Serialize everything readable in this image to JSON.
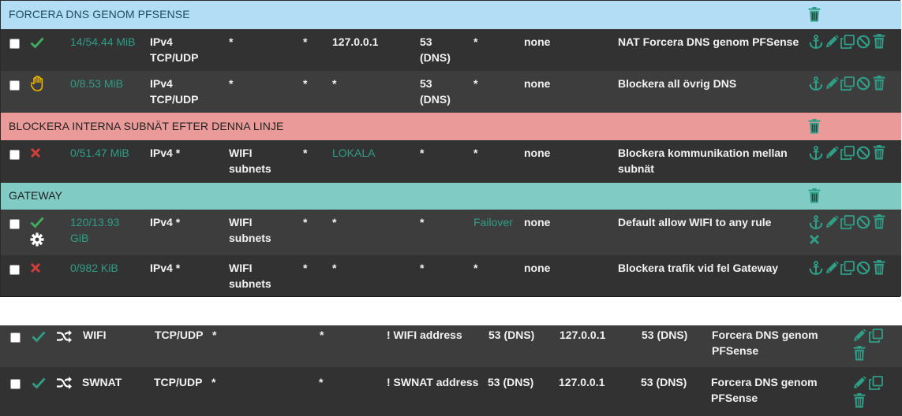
{
  "colors": {
    "accent": "#2e9e87",
    "sep_blue": "#b3ddf5",
    "sep_red": "#eb9a9a",
    "sep_teal": "#80cbc4"
  },
  "rules": {
    "sep1": "FORCERA DNS GENOM PFSENSE",
    "row1": {
      "states": "14/54.44 MiB",
      "proto1": "IPv4",
      "proto2": "TCP/UDP",
      "source": "*",
      "port": "*",
      "dest": "127.0.0.1",
      "dport1": "53",
      "dport2": "(DNS)",
      "gw": "*",
      "queue": "none",
      "desc": "NAT Forcera DNS genom PFSense"
    },
    "row2": {
      "states": "0/8.53 MiB",
      "proto1": "IPv4",
      "proto2": "TCP/UDP",
      "source": "*",
      "port": "*",
      "dest": "*",
      "dport1": "53",
      "dport2": "(DNS)",
      "gw": "*",
      "queue": "none",
      "desc": "Blockera all övrig DNS"
    },
    "sep2": "BLOCKERA INTERNA SUBNÄT EFTER DENNA LINJE",
    "row3": {
      "states": "0/51.47 MiB",
      "proto": "IPv4 *",
      "source1": "WIFI",
      "source2": "subnets",
      "port": "*",
      "dest": "LOKALA",
      "dport": "*",
      "gw": "*",
      "queue": "none",
      "desc1": "Blockera kommunikation mellan",
      "desc2": "subnät"
    },
    "sep3": "GATEWAY",
    "row4": {
      "states1": "120/13.93",
      "states2": "GiB",
      "proto": "IPv4 *",
      "source1": "WIFI",
      "source2": "subnets",
      "port": "*",
      "dest": "*",
      "dport": "*",
      "gateway": "Failover",
      "queue": "none",
      "desc": "Default allow WIFI to any rule"
    },
    "row5": {
      "states": "0/982 KiB",
      "proto": "IPv4 *",
      "source1": "WIFI",
      "source2": "subnets",
      "port": "*",
      "dest": "*",
      "dport": "*",
      "gw": "*",
      "queue": "none",
      "desc": "Blockera trafik vid fel Gateway"
    }
  },
  "nat": [
    {
      "iface": "WIFI",
      "proto": "TCP/UDP",
      "src": "*",
      "sport": "*",
      "dest": "! WIFI address",
      "dport": "53 (DNS)",
      "nat_ip": "127.0.0.1",
      "nat_port": "53 (DNS)",
      "desc1": "Forcera DNS genom",
      "desc2": "PFSense"
    },
    {
      "iface": "SWNAT",
      "proto": "TCP/UDP",
      "src": "*",
      "sport": "*",
      "dest": "! SWNAT address",
      "dport": "53 (DNS)",
      "nat_ip": "127.0.0.1",
      "nat_port": "53 (DNS)",
      "desc1": "Forcera DNS genom",
      "desc2": "PFSense"
    }
  ],
  "icons": [
    "check-icon",
    "hand-icon",
    "x-icon",
    "gear-icon",
    "anchor-icon",
    "pencil-icon",
    "copy-icon",
    "disable-icon",
    "trash-icon",
    "shuffle-icon"
  ]
}
